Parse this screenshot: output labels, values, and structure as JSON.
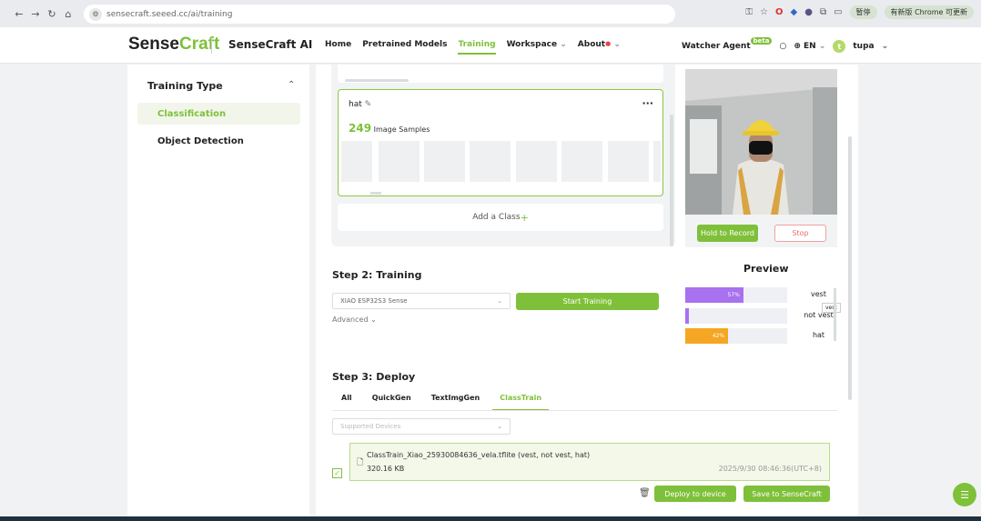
{
  "browser": {
    "url": "sensecraft.seeed.cc/ai/training",
    "profile_label": "暂停",
    "update_label": "有新版 Chrome 可更新"
  },
  "header": {
    "logo_part1": "Sense",
    "logo_part2": "Craft",
    "product": "SenseCraft AI",
    "menu": [
      "Home",
      "Pretrained Models",
      "Training",
      "Workspace",
      "About"
    ],
    "watcher_agent": "Watcher Agent",
    "beta_badge": "beta",
    "language": "EN",
    "user_initial": "t",
    "username": "tupa"
  },
  "sidebar": {
    "title": "Training Type",
    "items": [
      "Classification",
      "Object Detection"
    ]
  },
  "class_card": {
    "name": "hat",
    "sample_count": "249",
    "sample_label": "Image Samples",
    "add_class_label": "Add a Class"
  },
  "camera": {
    "record_label": "Hold to Record",
    "stop_label": "Stop"
  },
  "step2": {
    "title": "Step 2: Training",
    "device": "XIAO ESP32S3 Sense",
    "start_label": "Start Training",
    "advanced_label": "Advanced"
  },
  "preview": {
    "title": "Preview",
    "items": [
      {
        "label": "vest",
        "percent": 57,
        "color": "#a771f0"
      },
      {
        "label": "not vest",
        "percent": 0,
        "color": "#a771f0"
      },
      {
        "label": "hat",
        "percent": 42,
        "color": "#f5a623"
      }
    ],
    "tooltip": "vest"
  },
  "step3": {
    "title": "Step 3: Deploy",
    "tabs": [
      "All",
      "QuickGen",
      "TextImgGen",
      "ClassTrain"
    ],
    "device_placeholder": "Supported Devices",
    "model": {
      "name": "ClassTrain_Xiao_25930084636_vela.tflite (vest, not vest, hat)",
      "size": "320.16 KB",
      "timestamp": "2025/9/30 08:46:36(UTC+8)"
    },
    "deploy_label": "Deploy to device",
    "save_label": "Save to SenseCraft"
  }
}
